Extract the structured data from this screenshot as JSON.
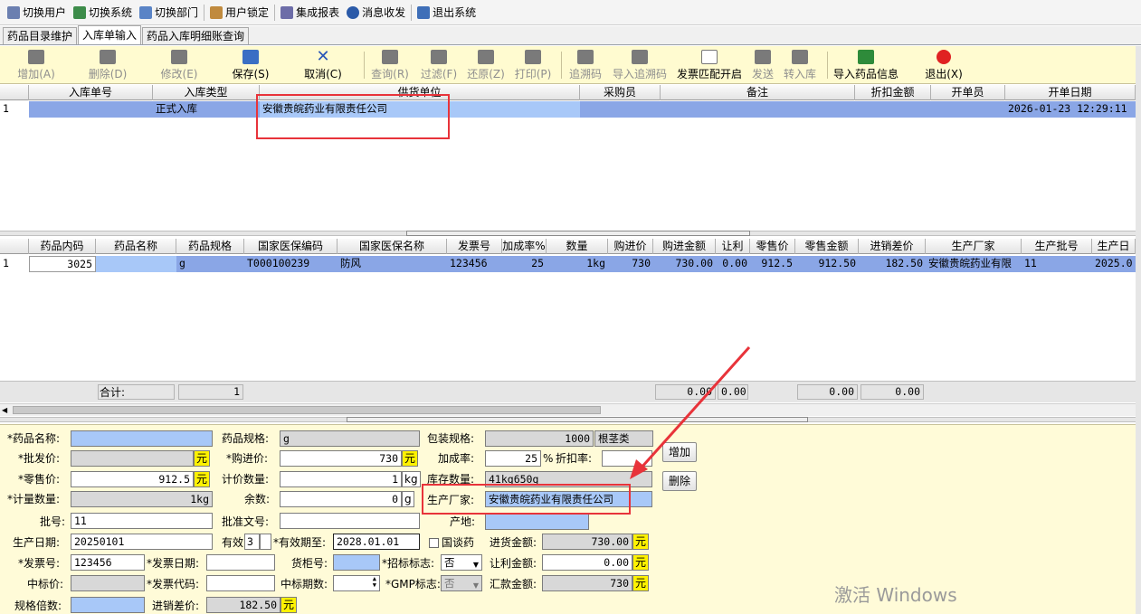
{
  "menubar": {
    "items": [
      {
        "label": "切换用户",
        "icon": "switch-user-icon"
      },
      {
        "label": "切换系统",
        "icon": "switch-system-icon"
      },
      {
        "label": "切换部门",
        "icon": "switch-department-icon"
      },
      {
        "label": "用户锁定",
        "icon": "lock-user-icon"
      },
      {
        "label": "集成报表",
        "icon": "report-icon"
      },
      {
        "label": "消息收发",
        "icon": "info-icon"
      },
      {
        "label": "退出系统",
        "icon": "exit-icon"
      }
    ]
  },
  "tabs": [
    {
      "label": "药品目录维护",
      "active": false
    },
    {
      "label": "入库单输入",
      "active": true
    },
    {
      "label": "药品入库明细账查询",
      "active": false
    }
  ],
  "toolbar": {
    "buttons": [
      {
        "label": "增加(A)",
        "enabled": false
      },
      {
        "label": "删除(D)",
        "enabled": false
      },
      {
        "label": "修改(E)",
        "enabled": false
      },
      {
        "label": "保存(S)",
        "enabled": true
      },
      {
        "label": "取消(C)",
        "enabled": true
      },
      {
        "label": "查询(R)",
        "enabled": false
      },
      {
        "label": "过滤(F)",
        "enabled": false
      },
      {
        "label": "还原(Z)",
        "enabled": false
      },
      {
        "label": "打印(P)",
        "enabled": false
      },
      {
        "label": "追溯码",
        "enabled": false
      },
      {
        "label": "导入追溯码",
        "enabled": false
      },
      {
        "label": "发票匹配开启",
        "enabled": true
      },
      {
        "label": "发送",
        "enabled": false
      },
      {
        "label": "转入库",
        "enabled": false
      },
      {
        "label": "导入药品信息",
        "enabled": true
      },
      {
        "label": "退出(X)",
        "enabled": true
      }
    ]
  },
  "master_grid": {
    "headers": [
      "入库单号",
      "入库类型",
      "供货单位",
      "采购员",
      "备注",
      "折扣金额",
      "开单员",
      "开单日期"
    ],
    "rows": [
      {
        "row_no": "1",
        "order_no": "",
        "type": "正式入库",
        "supplier": "安徽贵皖药业有限责任公司",
        "buyer": "",
        "remark": "",
        "discount": "",
        "issuer": "",
        "date": "2026-01-23 12:29:11"
      }
    ]
  },
  "detail_grid": {
    "headers": [
      "药品内码",
      "药品名称",
      "药品规格",
      "国家医保编码",
      "国家医保名称",
      "发票号",
      "加成率%",
      "数量",
      "购进价",
      "购进金额",
      "让利",
      "零售价",
      "零售金额",
      "进销差价",
      "生产厂家",
      "生产批号",
      "生产日"
    ],
    "rows": [
      {
        "row_no": "1",
        "code": "3025",
        "name": "",
        "spec": "g",
        "insurance_code": "T000100239",
        "insurance_name": "防风",
        "invoice_no": "123456",
        "markup": "25",
        "qty": "1kg",
        "price": "730",
        "amount": "730.00",
        "discount": "0.00",
        "retail_price": "912.5",
        "retail_amount": "912.50",
        "diff": "182.50",
        "maker": "安徽贵皖药业有限",
        "batch": "11",
        "prod_date": "2025.0"
      }
    ],
    "totals": {
      "label": "合计:",
      "count": "1",
      "amount": "0.00",
      "discount": "0.00",
      "retail_amount": "0.00",
      "diff": "0.00"
    }
  },
  "form": {
    "drug_name": {
      "label": "*药品名称:",
      "value": ""
    },
    "drug_spec": {
      "label": "药品规格:",
      "value": "g"
    },
    "pack_spec": {
      "label": "包装规格:",
      "value": "1000",
      "tag": "根茎类"
    },
    "wholesale": {
      "label": "*批发价:",
      "value": "",
      "unit": "元"
    },
    "purchase_price": {
      "label": "*购进价:",
      "value": "730",
      "unit": "元"
    },
    "markup": {
      "label": "加成率:",
      "value": "25",
      "unit": "%"
    },
    "discount_rate": {
      "label": "折扣率:",
      "value": ""
    },
    "retail": {
      "label": "*零售价:",
      "value": "912.5",
      "unit": "元"
    },
    "pricing_qty": {
      "label": "计价数量:",
      "value": "1",
      "unit": "kg"
    },
    "stock_qty": {
      "label": "库存数量:",
      "value": "41kg650g"
    },
    "measure_qty": {
      "label": "*计量数量:",
      "value": "1kg"
    },
    "remainder": {
      "label": "余数:",
      "value": "0",
      "unit": "g"
    },
    "manufacturer": {
      "label": "生产厂家:",
      "value": "安徽贵皖药业有限责任公司"
    },
    "batch": {
      "label": "批号:",
      "value": "11"
    },
    "approval": {
      "label": "批准文号:",
      "value": ""
    },
    "origin": {
      "label": "产地:",
      "value": ""
    },
    "prod_date": {
      "label": "生产日期:",
      "value": "20250101"
    },
    "valid": {
      "label": "有效",
      "value": "3"
    },
    "expire": {
      "label": "*有效期至:",
      "value": "2028.01.01"
    },
    "national_talk": {
      "label": "国谈药"
    },
    "purchase_amount": {
      "label": "进货金额:",
      "value": "730.00",
      "unit": "元"
    },
    "invoice_no": {
      "label": "*发票号:",
      "value": "123456"
    },
    "invoice_date": {
      "label": "*发票日期:",
      "value": ""
    },
    "shelf_no": {
      "label": "货柜号:",
      "value": ""
    },
    "bid_flag": {
      "label": "*招标标志:",
      "value": "否"
    },
    "discount_amount": {
      "label": "让利金额:",
      "value": "0.00",
      "unit": "元"
    },
    "bid_price": {
      "label": "中标价:",
      "value": ""
    },
    "invoice_code": {
      "label": "*发票代码:",
      "value": ""
    },
    "bid_period": {
      "label": "中标期数:",
      "value": ""
    },
    "gmp_flag": {
      "label": "*GMP标志:",
      "value": "否"
    },
    "remit_amount": {
      "label": "汇款金额:",
      "value": "730",
      "unit": "元"
    },
    "spec_multiple": {
      "label": "规格倍数:",
      "value": ""
    },
    "sale_diff": {
      "label": "进销差价:",
      "value": "182.50",
      "unit": "元"
    },
    "add_button": "增加",
    "delete_button": "删除"
  },
  "watermark": "激活 Windows",
  "colors": {
    "toolbar_bg": "#fffbd0",
    "selection": "#8aa6e6",
    "highlight": "#e8333a",
    "unit_bg": "#fff200"
  }
}
